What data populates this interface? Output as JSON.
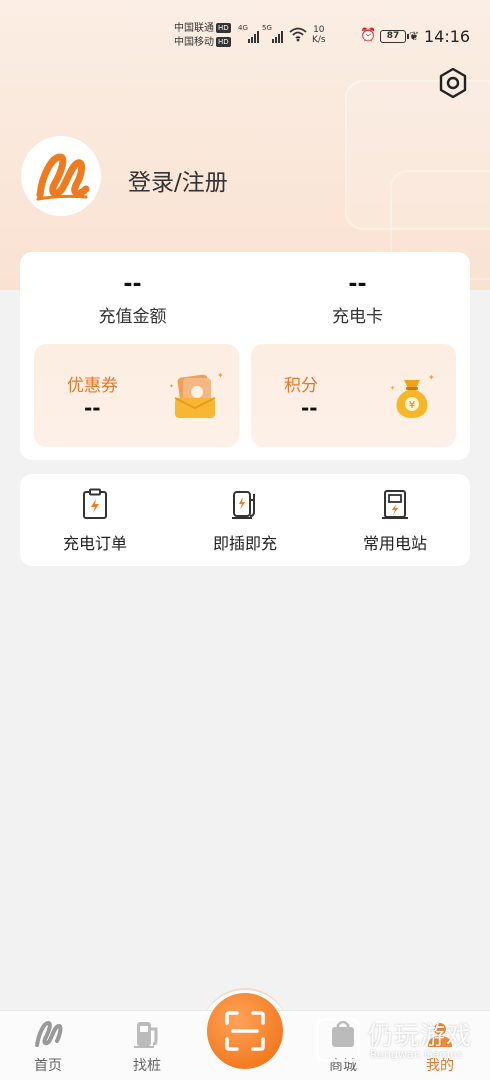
{
  "status_bar": {
    "carrier_1": "中国联通",
    "carrier_2": "中国移动",
    "hd_badge": "HD",
    "sig1_tag": "4G",
    "sig2_tag": "5G",
    "net_speed_value": "10",
    "net_speed_unit": "K/s",
    "battery": "87",
    "time": "14:16"
  },
  "header": {
    "settings_icon": "hexagon-gear-icon"
  },
  "profile": {
    "avatar_icon": "brand-logo-icon",
    "login_label": "登录/注册"
  },
  "stats": {
    "recharge_amount": {
      "value": "--",
      "label": "充值金额"
    },
    "charge_card": {
      "value": "--",
      "label": "充电卡"
    },
    "coupon": {
      "value": "--",
      "label": "优惠券",
      "icon": "coupon-gift-icon"
    },
    "points": {
      "value": "--",
      "label": "积分",
      "icon": "money-bag-icon"
    }
  },
  "actions": [
    {
      "label": "充电订单",
      "icon": "clipboard-bolt-icon"
    },
    {
      "label": "即插即充",
      "icon": "plug-charger-icon"
    },
    {
      "label": "常用电站",
      "icon": "station-icon"
    }
  ],
  "tabbar": {
    "home": "首页",
    "find": "找桩",
    "scan_icon": "scan-icon",
    "mall": "商城",
    "mine": "我的"
  },
  "watermark": {
    "cn": "仍玩游戏",
    "en": "Rengwan Games"
  },
  "colors": {
    "accent": "#f37c22",
    "accent_text": "#e8782a",
    "header_bg": "#fbeee4",
    "page_bg": "#f2f2f2"
  }
}
